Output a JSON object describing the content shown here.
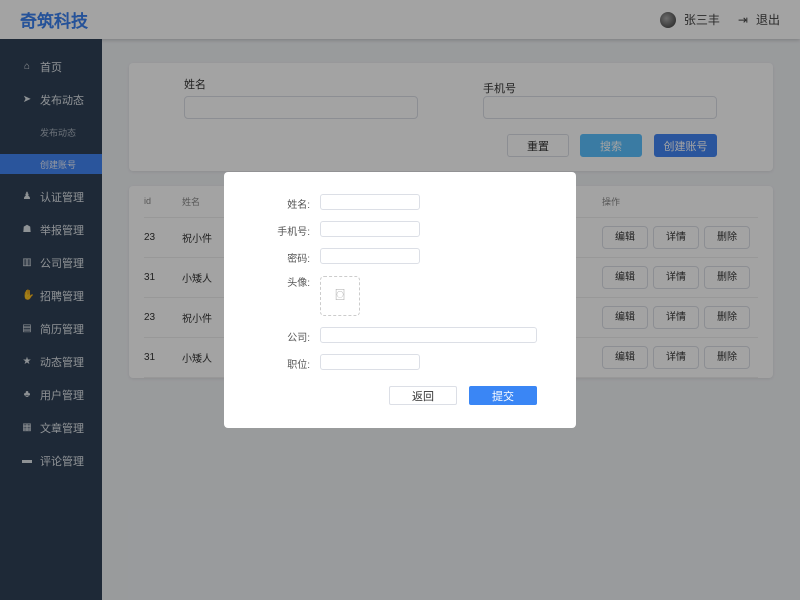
{
  "header": {
    "logo": "奇筑科技",
    "user": "张三丰",
    "logout": "退出"
  },
  "sidebar": {
    "items": [
      {
        "label": "首页",
        "icon": "⌂"
      },
      {
        "label": "发布动态",
        "icon": "➤"
      }
    ],
    "subs": [
      "发布动态",
      "创建账号"
    ],
    "items2": [
      {
        "label": "认证管理",
        "icon": "♟"
      },
      {
        "label": "举报管理",
        "icon": "☗"
      },
      {
        "label": "公司管理",
        "icon": "▥"
      },
      {
        "label": "招聘管理",
        "icon": "✋"
      },
      {
        "label": "简历管理",
        "icon": "▤"
      },
      {
        "label": "动态管理",
        "icon": "★"
      },
      {
        "label": "用户管理",
        "icon": "♣"
      },
      {
        "label": "文章管理",
        "icon": "▦"
      },
      {
        "label": "评论管理",
        "icon": "▬"
      }
    ]
  },
  "search": {
    "name_label": "姓名",
    "phone_label": "手机号",
    "reset": "重置",
    "search": "搜索",
    "create": "创建账号"
  },
  "table": {
    "headers": {
      "id": "id",
      "name": "姓名",
      "ops": "操作"
    },
    "rows": [
      {
        "id": "23",
        "name": "祝小件"
      },
      {
        "id": "31",
        "name": "小矮人"
      },
      {
        "id": "23",
        "name": "祝小件"
      },
      {
        "id": "31",
        "name": "小矮人"
      }
    ],
    "edit": "编辑",
    "detail": "详情",
    "delete": "删除"
  },
  "modal": {
    "name": "姓名:",
    "phone": "手机号:",
    "password": "密码:",
    "avatar": "头像:",
    "company": "公司:",
    "position": "职位:",
    "back": "返回",
    "submit": "提交"
  }
}
